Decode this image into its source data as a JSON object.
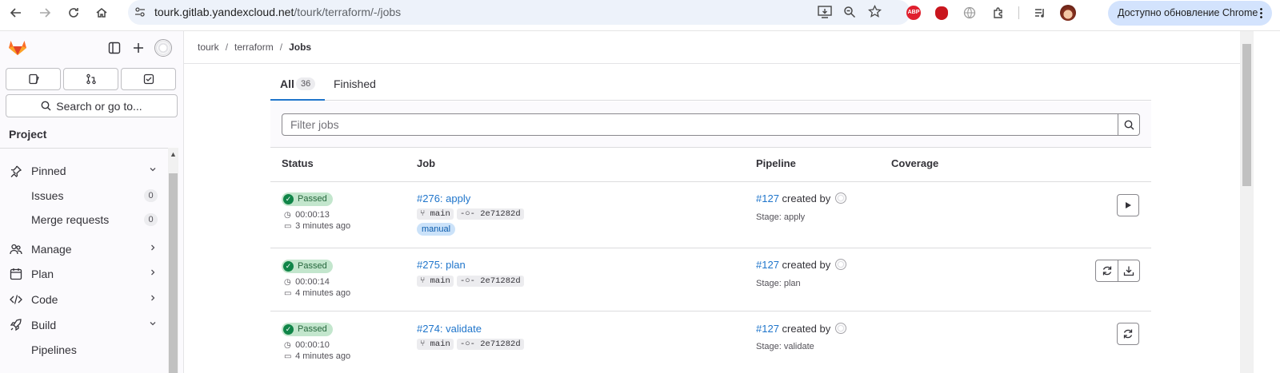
{
  "browser": {
    "url_host": "tourk.gitlab.yandexcloud.net",
    "url_path": "/tourk/terraform/-/jobs",
    "update_label": "Доступно обновление Chrome",
    "abp_label": "ABP"
  },
  "sidebar": {
    "search_label": "Search or go to...",
    "section_title": "Project",
    "items": [
      {
        "label": "Pinned",
        "icon": "pin-icon"
      },
      {
        "label": "Issues",
        "count": "0"
      },
      {
        "label": "Merge requests",
        "count": "0"
      },
      {
        "label": "Manage",
        "icon": "users-icon"
      },
      {
        "label": "Plan",
        "icon": "planning-icon"
      },
      {
        "label": "Code",
        "icon": "code-icon"
      },
      {
        "label": "Build",
        "icon": "rocket-icon"
      },
      {
        "label": "Pipelines"
      }
    ]
  },
  "breadcrumb": {
    "items": [
      "tourk",
      "terraform"
    ],
    "current": "Jobs",
    "separator": "/"
  },
  "tabs": {
    "all_label": "All",
    "all_count": "36",
    "finished_label": "Finished"
  },
  "filter": {
    "placeholder": "Filter jobs"
  },
  "table": {
    "headers": {
      "status": "Status",
      "job": "Job",
      "pipeline": "Pipeline",
      "coverage": "Coverage"
    },
    "rows": [
      {
        "status": "Passed",
        "duration": "00:00:13",
        "finished": "3 minutes ago",
        "job": "#276: apply",
        "branch": "main",
        "commit": "2e71282d",
        "tag": "manual",
        "pipeline": "#127",
        "created_by": "created by",
        "stage": "Stage: apply"
      },
      {
        "status": "Passed",
        "duration": "00:00:14",
        "finished": "4 minutes ago",
        "job": "#275: plan",
        "branch": "main",
        "commit": "2e71282d",
        "pipeline": "#127",
        "created_by": "created by",
        "stage": "Stage: plan"
      },
      {
        "status": "Passed",
        "duration": "00:00:10",
        "finished": "4 minutes ago",
        "job": "#274: validate",
        "branch": "main",
        "commit": "2e71282d",
        "pipeline": "#127",
        "created_by": "created by",
        "stage": "Stage: validate"
      }
    ]
  },
  "colors": {
    "link": "#1f75cb",
    "success_bg": "#c3e6cd",
    "success": "#108548",
    "tab_accent": "#1f75cb"
  }
}
